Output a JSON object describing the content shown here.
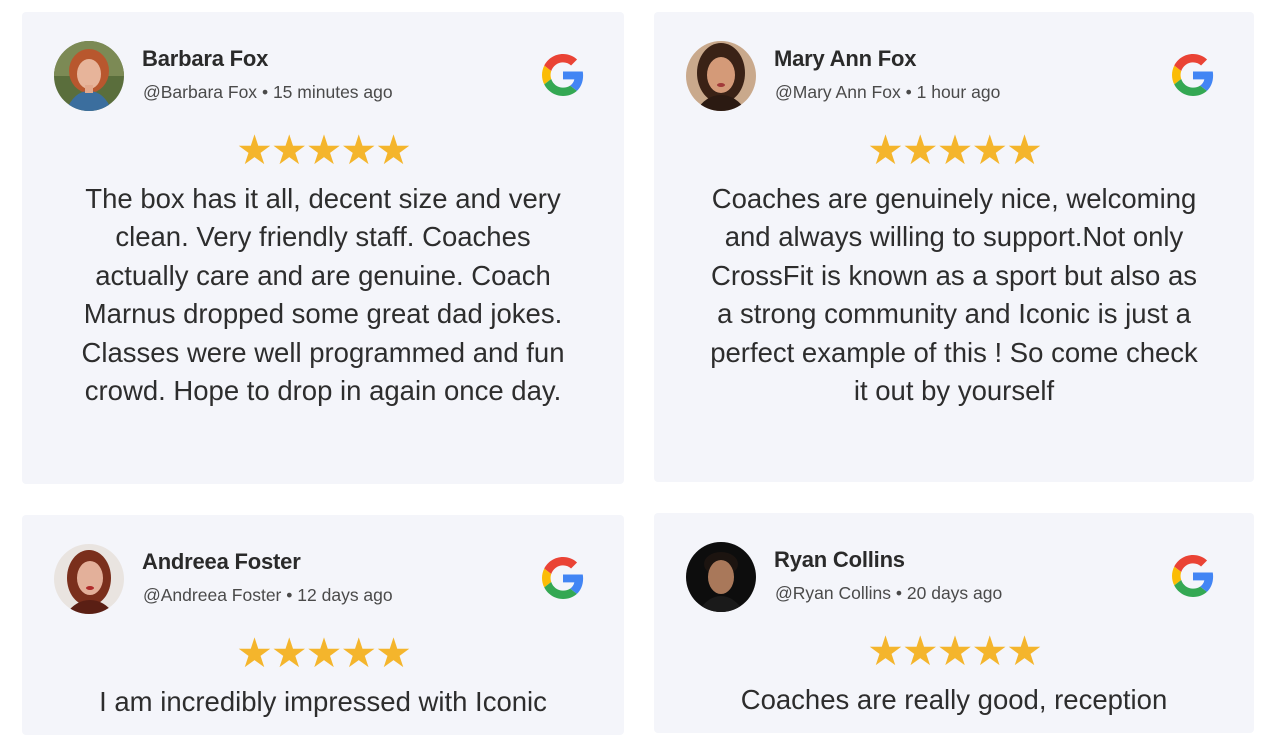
{
  "reviews": [
    {
      "name": "Barbara Fox",
      "handle": "@Barbara Fox",
      "time": "15 minutes ago",
      "rating": 5,
      "text": "The box has it all, decent size and very clean. Very friendly staff. Coaches actually care and are genuine. Coach Marnus dropped some great dad jokes. Classes were well programmed and fun crowd. Hope to drop in again once day."
    },
    {
      "name": "Mary Ann Fox",
      "handle": "@Mary Ann Fox",
      "time": "1 hour ago",
      "rating": 5,
      "text": "Coaches are genuinely nice, welcoming and always willing to support.Not only CrossFit is known as a sport but also as a strong community and Iconic is just a perfect example of this ! So come check it out by yourself"
    },
    {
      "name": "Andreea Foster",
      "handle": "@Andreea Foster",
      "time": "12 days ago",
      "rating": 5,
      "text": "I am incredibly impressed with Iconic"
    },
    {
      "name": "Ryan Collins",
      "handle": "@Ryan Collins",
      "time": "20 days ago",
      "rating": 5,
      "text": "Coaches are really good, reception"
    }
  ],
  "separator": "•",
  "icons": {
    "source": "google-icon",
    "star": "star-icon"
  },
  "colors": {
    "card_bg": "#f4f5fa",
    "star": "#f4b52c",
    "google_blue": "#4285F4",
    "google_red": "#EA4335",
    "google_yellow": "#FBBC05",
    "google_green": "#34A853"
  }
}
